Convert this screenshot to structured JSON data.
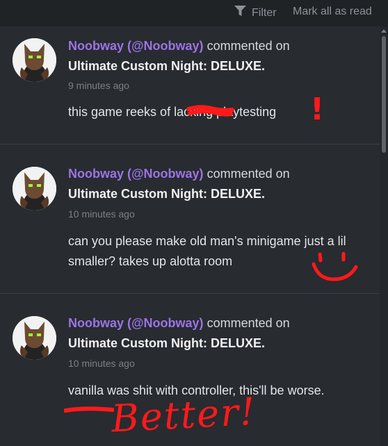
{
  "toolbar": {
    "filter_label": "Filter",
    "filter_icon": "filter-funnel-icon",
    "mark_all_label": "Mark all as read"
  },
  "notifications": [
    {
      "user": "Noobway (@Noobway)",
      "action": "commented on",
      "target": "Ultimate Custom Night: DELUXE.",
      "time": "9 minutes ago",
      "body": "this game reeks of lacking playtesting"
    },
    {
      "user": "Noobway (@Noobway)",
      "action": "commented on",
      "target": "Ultimate Custom Night: DELUXE.",
      "time": "10 minutes ago",
      "body": "can you please make old man's minigame just a lil smaller? takes up alotta room"
    },
    {
      "user": "Noobway (@Noobway)",
      "action": "commented on",
      "target": "Ultimate Custom Night: DELUXE.",
      "time": "10 minutes ago",
      "body": "vanilla was shit with controller, this'll be worse."
    }
  ],
  "annotations": {
    "color": "#ff1a1a",
    "exclamation": "!",
    "better": "Better!"
  },
  "colors": {
    "username": "#9a74e6",
    "panel_bg": "#282b30",
    "header_bg": "#202326"
  }
}
